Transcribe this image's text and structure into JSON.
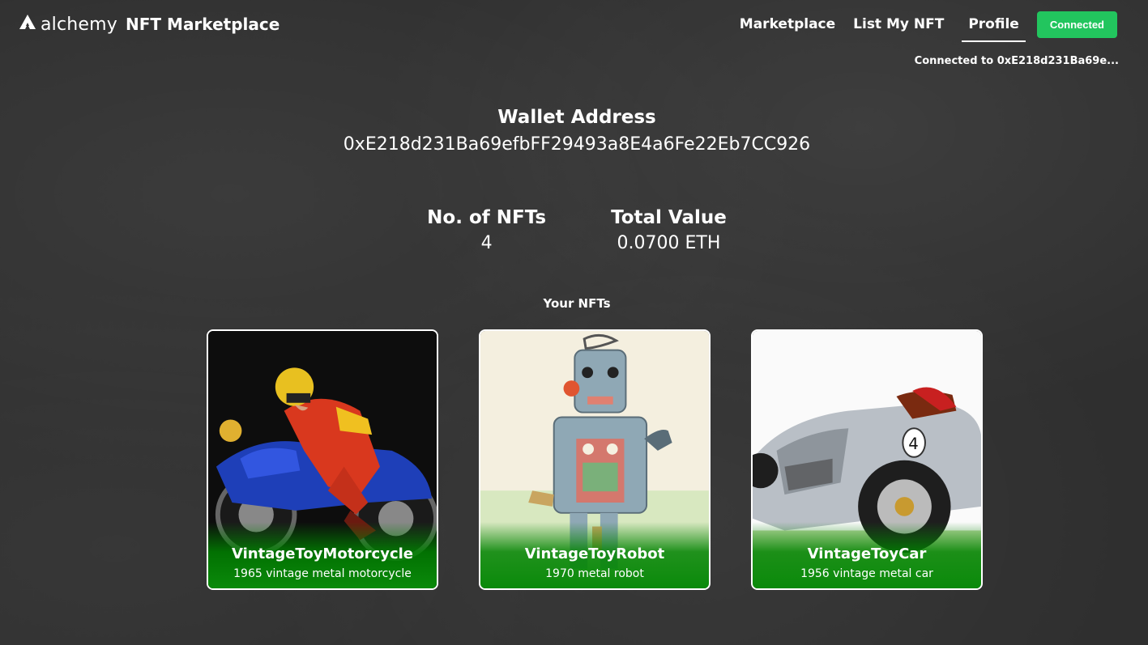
{
  "header": {
    "brand": "alchemy",
    "title": "NFT Marketplace",
    "nav": [
      "Marketplace",
      "List My NFT",
      "Profile"
    ],
    "active": "Profile",
    "connect_label": "Connected",
    "connection_status": "Connected to 0xE218d231Ba69e..."
  },
  "profile": {
    "wallet_label": "Wallet Address",
    "wallet_address": "0xE218d231Ba69efbFF29493a8E4a6Fe22Eb7CC926",
    "nft_count_label": "No. of NFTs",
    "nft_count": "4",
    "total_value_label": "Total Value",
    "total_value": "0.0700 ETH",
    "section_title": "Your NFTs"
  },
  "nfts": [
    {
      "name": "VintageToyMotorcycle",
      "description": "1965 vintage metal motorcycle"
    },
    {
      "name": "VintageToyRobot",
      "description": "1970 metal robot"
    },
    {
      "name": "VintageToyCar",
      "description": "1956 vintage metal car"
    }
  ],
  "colors": {
    "accent": "#22c55e",
    "background": "#2f2f2f",
    "card_overlay": "#0a8a0a"
  }
}
